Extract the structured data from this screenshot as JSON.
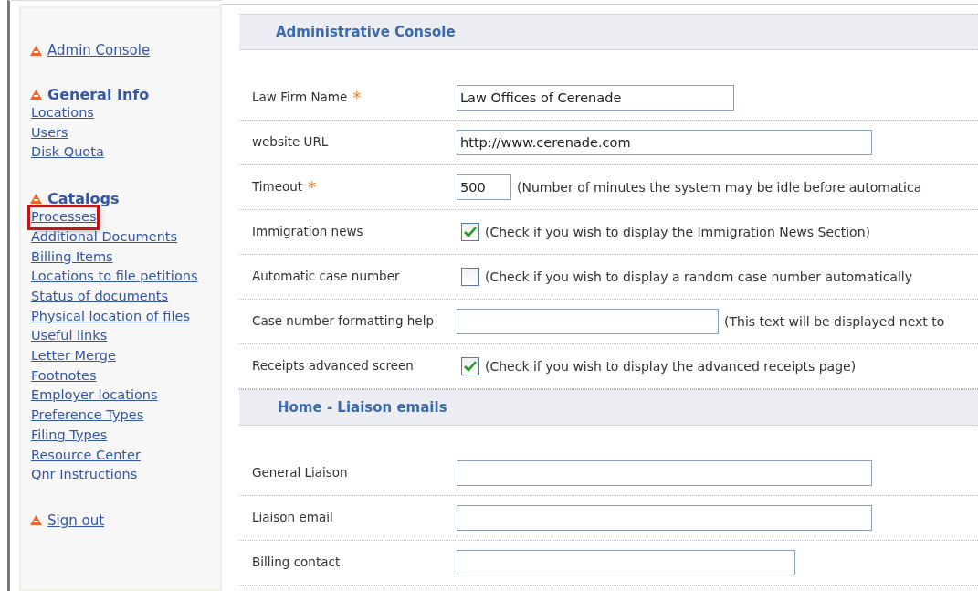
{
  "sidebar": {
    "groups": [
      {
        "title": "Admin Console",
        "kind": "link"
      },
      {
        "title": "General Info",
        "kind": "heading",
        "items": [
          {
            "label": "Locations",
            "highlighted": false
          },
          {
            "label": "Users",
            "highlighted": false
          },
          {
            "label": "Disk Quota",
            "highlighted": false
          }
        ]
      },
      {
        "title": "Catalogs",
        "kind": "heading",
        "items": [
          {
            "label": "Processes",
            "highlighted": true
          },
          {
            "label": "Additional Documents",
            "highlighted": false
          },
          {
            "label": "Billing Items",
            "highlighted": false
          },
          {
            "label": "Locations to file petitions",
            "highlighted": false
          },
          {
            "label": "Status of documents",
            "highlighted": false
          },
          {
            "label": "Physical location of files",
            "highlighted": false
          },
          {
            "label": "Useful links",
            "highlighted": false
          },
          {
            "label": "Letter Merge",
            "highlighted": false
          },
          {
            "label": "Footnotes",
            "highlighted": false
          },
          {
            "label": "Employer locations",
            "highlighted": false
          },
          {
            "label": "Preference Types",
            "highlighted": false
          },
          {
            "label": "Filing Types",
            "highlighted": false
          },
          {
            "label": "Resource Center",
            "highlighted": false
          },
          {
            "label": "Qnr Instructions",
            "highlighted": false
          }
        ]
      },
      {
        "title": "Sign out",
        "kind": "link"
      }
    ]
  },
  "sections": [
    {
      "title": "Administrative Console",
      "rows": [
        {
          "label": "Law Firm Name",
          "required_mark": "*",
          "kind": "text",
          "value": "Law Offices of Cerenade"
        },
        {
          "label": "website URL",
          "kind": "text",
          "value": "http://www.cerenade.com"
        },
        {
          "label": "Timeout",
          "required_mark": "*",
          "kind": "text",
          "value": "500",
          "hint": "(Number of minutes the system may be idle before automatica"
        },
        {
          "label": "Immigration news",
          "kind": "checkbox",
          "checked": true,
          "hint": "(Check if you wish to display the Immigration News Section)"
        },
        {
          "label": "Automatic case number",
          "kind": "checkbox",
          "checked": false,
          "hint": "(Check if you wish to display a random case number automatically"
        },
        {
          "label": "Case number formatting help",
          "kind": "text",
          "hint": "(This text will be displayed next to"
        },
        {
          "label": "Receipts advanced screen",
          "kind": "checkbox",
          "checked": true,
          "hint": "(Check if you wish to display the advanced receipts page)"
        }
      ]
    },
    {
      "title": "Home - Liaison emails",
      "rows": [
        {
          "label": "General Liaison",
          "kind": "text"
        },
        {
          "label": "Liaison email",
          "kind": "text"
        },
        {
          "label": "Billing contact",
          "kind": "text"
        }
      ]
    }
  ]
}
